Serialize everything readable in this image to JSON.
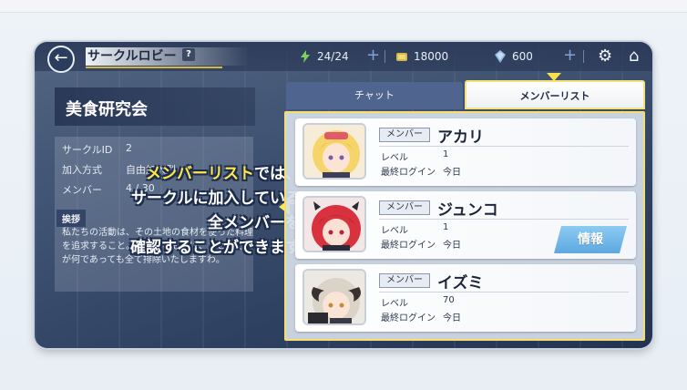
{
  "header": {
    "title": "サークルロビー",
    "help_label": "?",
    "stamina": "24/24",
    "coins": "18000",
    "gems": "600"
  },
  "circle": {
    "name": "美食研究会",
    "rows": [
      {
        "label": "サークルID",
        "value": "2"
      },
      {
        "label": "加入方式",
        "value": "自由加入型"
      },
      {
        "label": "メンバー",
        "value": "4 / 30"
      }
    ],
    "greeting_label": "挨拶",
    "greeting_text": "私たちの活動は、その土地の食材を使った料理を追求すること。邪魔するものは、たとえそれが何であっても全て排除いたしますわ。"
  },
  "caption": {
    "line1_highlight": "メンバーリスト",
    "line1_rest": "では、",
    "line2": "サークルに加入している",
    "line3": "全メンバーを",
    "line4": "確認することができます"
  },
  "tabs": {
    "chat": "チャット",
    "members": "メンバーリスト"
  },
  "members": [
    {
      "role": "メンバー",
      "name": "アカリ",
      "level_label": "レベル",
      "level": "1",
      "login_label": "最終ログイン",
      "login": "今日"
    },
    {
      "role": "メンバー",
      "name": "ジュンコ",
      "level_label": "レベル",
      "level": "1",
      "login_label": "最終ログイン",
      "login": "今日",
      "button": "情報"
    },
    {
      "role": "メンバー",
      "name": "イズミ",
      "level_label": "レベル",
      "level": "70",
      "login_label": "最終ログイン",
      "login": "今日"
    }
  ],
  "colors": {
    "accent_yellow": "#f5df6c",
    "info_button": "#5da8e0"
  }
}
